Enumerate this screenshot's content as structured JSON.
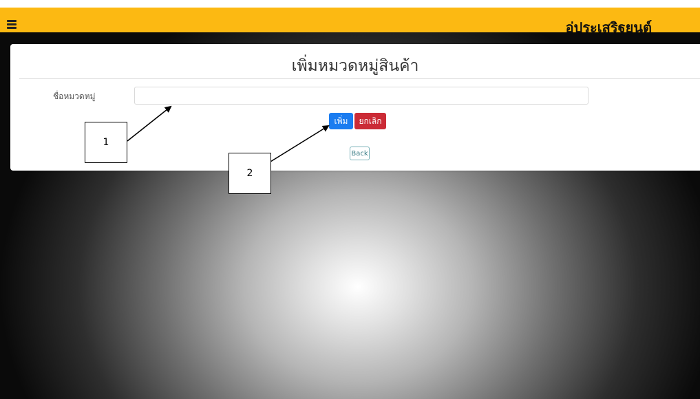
{
  "header": {
    "brand": "อู่ประเสริฐยนต์",
    "menu_icon": "hamburger-icon",
    "bar_color": "#fcb912"
  },
  "form": {
    "title": "เพิ่มหมวดหมู่สินค้า",
    "category_label": "ชื่อหมวดหมู่",
    "category_value": "",
    "category_placeholder": "",
    "add_label": "เพิ่ม",
    "cancel_label": "ยกเลิก",
    "back_label": "Back",
    "add_color": "#1a7cf0",
    "cancel_color": "#cb2b36"
  },
  "annotations": {
    "callout_1": "1",
    "callout_2": "2"
  }
}
